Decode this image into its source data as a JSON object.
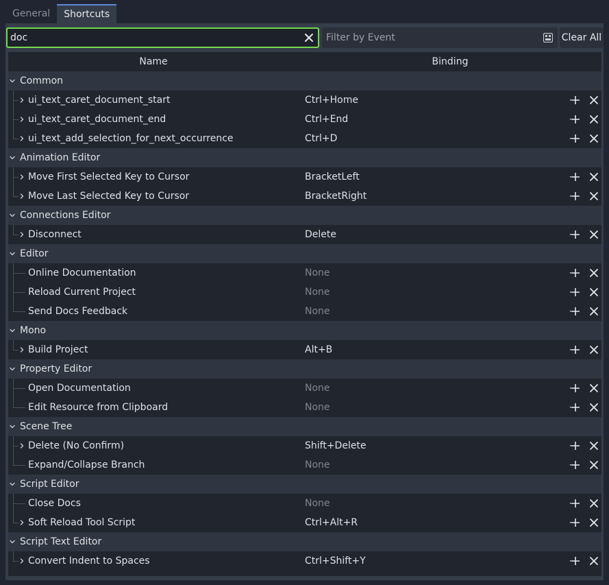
{
  "tabs": [
    {
      "label": "General",
      "active": false
    },
    {
      "label": "Shortcuts",
      "active": true
    }
  ],
  "search": {
    "value": "doc",
    "placeholder": ""
  },
  "filter": {
    "placeholder": "Filter by Event"
  },
  "clear_all_label": "Clear All",
  "columns": {
    "name": "Name",
    "binding": "Binding"
  },
  "icons": {
    "clear": "close-icon",
    "keyboard": "keyboard-icon",
    "expand": "chevron-right-icon",
    "collapse": "chevron-down-icon",
    "add": "plus-icon",
    "remove": "close-icon"
  },
  "colors": {
    "search_focus_border": "#75d94c",
    "tab_active_accent": "#5f89d1",
    "category_row": "#2f3541",
    "none_text": "#80858e"
  },
  "tree": [
    {
      "category": "Common",
      "items": [
        {
          "name": "ui_text_caret_document_start",
          "binding": "Ctrl+Home",
          "expandable": true
        },
        {
          "name": "ui_text_caret_document_end",
          "binding": "Ctrl+End",
          "expandable": true
        },
        {
          "name": "ui_text_add_selection_for_next_occurrence",
          "binding": "Ctrl+D",
          "expandable": true
        }
      ]
    },
    {
      "category": "Animation Editor",
      "items": [
        {
          "name": "Move First Selected Key to Cursor",
          "binding": "BracketLeft",
          "expandable": true
        },
        {
          "name": "Move Last Selected Key to Cursor",
          "binding": "BracketRight",
          "expandable": true
        }
      ]
    },
    {
      "category": "Connections Editor",
      "items": [
        {
          "name": "Disconnect",
          "binding": "Delete",
          "expandable": true
        }
      ]
    },
    {
      "category": "Editor",
      "items": [
        {
          "name": "Online Documentation",
          "binding": "None",
          "expandable": false
        },
        {
          "name": "Reload Current Project",
          "binding": "None",
          "expandable": false
        },
        {
          "name": "Send Docs Feedback",
          "binding": "None",
          "expandable": false
        }
      ]
    },
    {
      "category": "Mono",
      "items": [
        {
          "name": "Build Project",
          "binding": "Alt+B",
          "expandable": true
        }
      ]
    },
    {
      "category": "Property Editor",
      "items": [
        {
          "name": "Open Documentation",
          "binding": "None",
          "expandable": false
        },
        {
          "name": "Edit Resource from Clipboard",
          "binding": "None",
          "expandable": false
        }
      ]
    },
    {
      "category": "Scene Tree",
      "items": [
        {
          "name": "Delete (No Confirm)",
          "binding": "Shift+Delete",
          "expandable": true
        },
        {
          "name": "Expand/Collapse Branch",
          "binding": "None",
          "expandable": false
        }
      ]
    },
    {
      "category": "Script Editor",
      "items": [
        {
          "name": "Close Docs",
          "binding": "None",
          "expandable": false
        },
        {
          "name": "Soft Reload Tool Script",
          "binding": "Ctrl+Alt+R",
          "expandable": true
        }
      ]
    },
    {
      "category": "Script Text Editor",
      "items": [
        {
          "name": "Convert Indent to Spaces",
          "binding": "Ctrl+Shift+Y",
          "expandable": true
        }
      ]
    }
  ]
}
